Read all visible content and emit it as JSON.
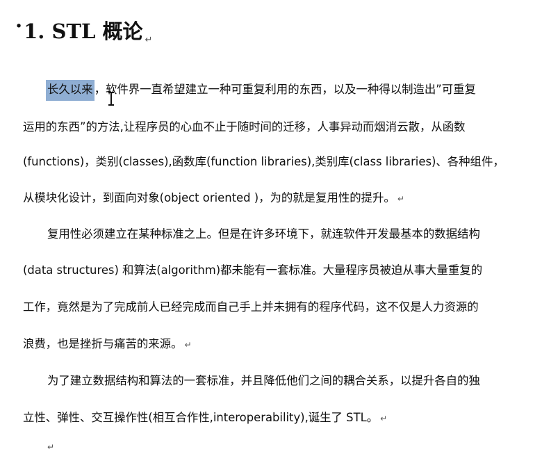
{
  "heading": {
    "bullet": "·",
    "text": "1. STL 概论",
    "mark": "↵"
  },
  "paragraph_mark": "↵",
  "paragraphs": [
    {
      "lines": [
        {
          "highlight": "长久以来",
          "text": "，软件界一直希望建立一种可重复利用的东西，以及一种得以制造出”可重复"
        },
        {
          "text": "运用的东西”的方法,让程序员的心血不止于随时间的迁移，人事异动而烟消云散，从函数"
        },
        {
          "text": "(functions)，类别(classes),函数库(function libraries),类别库(class libraries)、各种组件，"
        },
        {
          "text": "从模块化设计，到面向对象(object oriented )，为的就是复用性的提升。",
          "mark": "↵"
        }
      ]
    },
    {
      "lines": [
        {
          "text": "复用性必须建立在某种标准之上。但是在许多环境下，就连软件开发最基本的数据结构"
        },
        {
          "text": "(data structures) 和算法(algorithm)都未能有一套标准。大量程序员被迫从事大量重复的"
        },
        {
          "text": "工作，竟然是为了完成前人已经完成而自己手上并未拥有的程序代码，这不仅是人力资源的"
        },
        {
          "text": "浪费，也是挫折与痛苦的来源。",
          "mark": "↵"
        }
      ]
    },
    {
      "lines": [
        {
          "text": "为了建立数据结构和算法的一套标准，并且降低他们之间的耦合关系，以提升各自的独"
        },
        {
          "text": "立性、弹性、交互操作性(相互合作性,interoperability),诞生了 STL。",
          "mark": "↵"
        }
      ]
    }
  ],
  "end_mark": "↵",
  "colors": {
    "selection_highlight": "#8faed3",
    "text": "#111111",
    "background": "#ffffff"
  }
}
